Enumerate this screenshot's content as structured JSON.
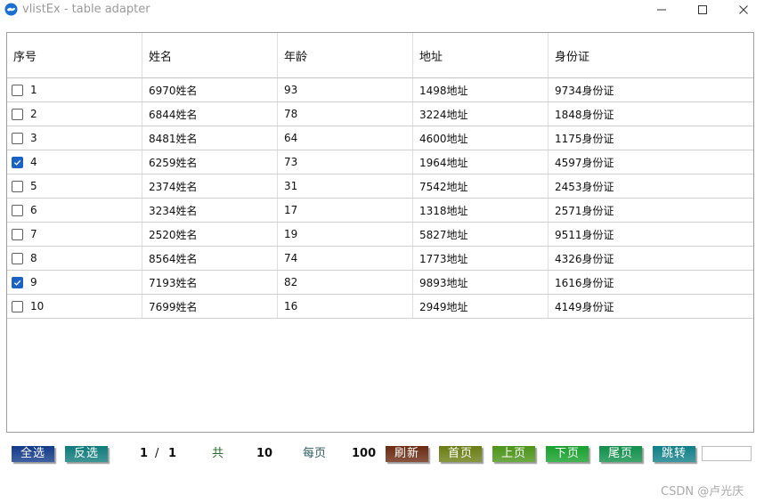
{
  "window": {
    "title": "vlistEx - table adapter"
  },
  "table": {
    "columns": [
      "序号",
      "姓名",
      "年龄",
      "地址",
      "身份证"
    ],
    "rows": [
      {
        "checked": false,
        "index": "1",
        "name": "6970姓名",
        "age": "93",
        "address": "1498地址",
        "id": "9734身份证"
      },
      {
        "checked": false,
        "index": "2",
        "name": "6844姓名",
        "age": "78",
        "address": "3224地址",
        "id": "1848身份证"
      },
      {
        "checked": false,
        "index": "3",
        "name": "8481姓名",
        "age": "64",
        "address": "4600地址",
        "id": "1175身份证"
      },
      {
        "checked": true,
        "index": "4",
        "name": "6259姓名",
        "age": "73",
        "address": "1964地址",
        "id": "4597身份证"
      },
      {
        "checked": false,
        "index": "5",
        "name": "2374姓名",
        "age": "31",
        "address": "7542地址",
        "id": "2453身份证"
      },
      {
        "checked": false,
        "index": "6",
        "name": "3234姓名",
        "age": "17",
        "address": "1318地址",
        "id": "2571身份证"
      },
      {
        "checked": false,
        "index": "7",
        "name": "2520姓名",
        "age": "19",
        "address": "5827地址",
        "id": "9511身份证"
      },
      {
        "checked": false,
        "index": "8",
        "name": "8564姓名",
        "age": "74",
        "address": "1773地址",
        "id": "4326身份证"
      },
      {
        "checked": true,
        "index": "9",
        "name": "7193姓名",
        "age": "82",
        "address": "9893地址",
        "id": "1616身份证"
      },
      {
        "checked": false,
        "index": "10",
        "name": "7699姓名",
        "age": "16",
        "address": "2949地址",
        "id": "4149身份证"
      }
    ]
  },
  "toolbar": {
    "select_all": "全选",
    "invert_select": "反选",
    "page_current": "1",
    "page_sep": "/",
    "page_total": "1",
    "total_label": "共",
    "total_count": "10",
    "per_page_label": "每页",
    "per_page_value": "100",
    "refresh": "刷新",
    "first_page": "首页",
    "prev_page": "上页",
    "next_page": "下页",
    "last_page": "尾页",
    "jump": "跳转",
    "jump_value": ""
  },
  "watermark": "CSDN @卢光庆",
  "colors": {
    "select_all": "#123a8a",
    "invert_select": "#0f7b7b",
    "refresh": "#6b2a12",
    "first_page": "#6a7d12",
    "prev_page": "#4b9418",
    "next_page": "#17a02c",
    "last_page": "#0f8f4a",
    "jump": "#0f7f87"
  }
}
